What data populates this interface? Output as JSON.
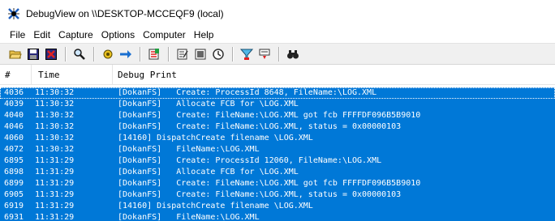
{
  "window": {
    "title": "DebugView on \\\\DESKTOP-MCCEQF9 (local)"
  },
  "menu": [
    "File",
    "Edit",
    "Capture",
    "Options",
    "Computer",
    "Help"
  ],
  "toolbar": {
    "icons": [
      "open-icon",
      "save-icon",
      "erase-icon",
      "find-icon",
      "capture-icon",
      "autoscroll-icon",
      "clear-display-icon",
      "properties-icon",
      "memory-icon",
      "clock-icon",
      "filter-icon",
      "highlight-icon",
      "binoculars-icon"
    ]
  },
  "columns": {
    "num": "#",
    "time": "Time",
    "print": "Debug Print"
  },
  "rows": [
    {
      "num": "4036",
      "time": "11:30:32",
      "text": "[DokanFS]   Create: ProcessId 8648, FileName:\\LOG.XML"
    },
    {
      "num": "4039",
      "time": "11:30:32",
      "text": "[DokanFS]   Allocate FCB for \\LOG.XML"
    },
    {
      "num": "4040",
      "time": "11:30:32",
      "text": "[DokanFS]   Create: FileName:\\LOG.XML got fcb FFFFDF096B5B9010"
    },
    {
      "num": "4046",
      "time": "11:30:32",
      "text": "[DokanFS]   Create: FileName:\\LOG.XML, status = 0x00000103"
    },
    {
      "num": "4060",
      "time": "11:30:32",
      "text": "[14160] DispatchCreate filename \\LOG.XML"
    },
    {
      "num": "4072",
      "time": "11:30:32",
      "text": "[DokanFS]   FileName:\\LOG.XML"
    },
    {
      "num": "6895",
      "time": "11:31:29",
      "text": "[DokanFS]   Create: ProcessId 12060, FileName:\\LOG.XML"
    },
    {
      "num": "6898",
      "time": "11:31:29",
      "text": "[DokanFS]   Allocate FCB for \\LOG.XML"
    },
    {
      "num": "6899",
      "time": "11:31:29",
      "text": "[DokanFS]   Create: FileName:\\LOG.XML got fcb FFFFDF096B5B9010"
    },
    {
      "num": "6905",
      "time": "11:31:29",
      "text": "[DokanFS]   Create: FileName:\\LOG.XML, status = 0x00000103"
    },
    {
      "num": "6919",
      "time": "11:31:29",
      "text": "[14160] DispatchCreate filename \\LOG.XML"
    },
    {
      "num": "6931",
      "time": "11:31:29",
      "text": "[DokanFS]   FileName:\\LOG.XML"
    }
  ],
  "colors": {
    "selection": "#0078d7",
    "toolbar": "#f0f0f0"
  }
}
